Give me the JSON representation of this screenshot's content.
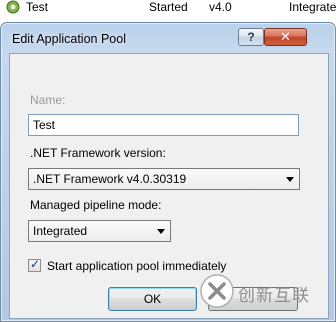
{
  "background": {
    "rows": [
      {
        "name": "Test",
        "status": "Started",
        "version": "v4.0",
        "pipeline": "Integrated"
      }
    ]
  },
  "dialog": {
    "title": "Edit Application Pool",
    "help_label": "?",
    "close_label": "✕",
    "name_label": "Name:",
    "name_value": "Test",
    "framework_label": ".NET Framework version:",
    "framework_value": ".NET Framework v4.0.30319",
    "pipeline_label": "Managed pipeline mode:",
    "pipeline_value": "Integrated",
    "start_checkbox_label": "Start application pool immediately",
    "start_checked": true,
    "ok_label": "OK",
    "cancel_label": ""
  },
  "watermark": {
    "text": "创新互联"
  },
  "colors": {
    "titlebar_glass": "#bcd0e6",
    "close_button": "#c2432a",
    "client_bg": "#f0f0f0",
    "check": "#1e3a8a"
  }
}
